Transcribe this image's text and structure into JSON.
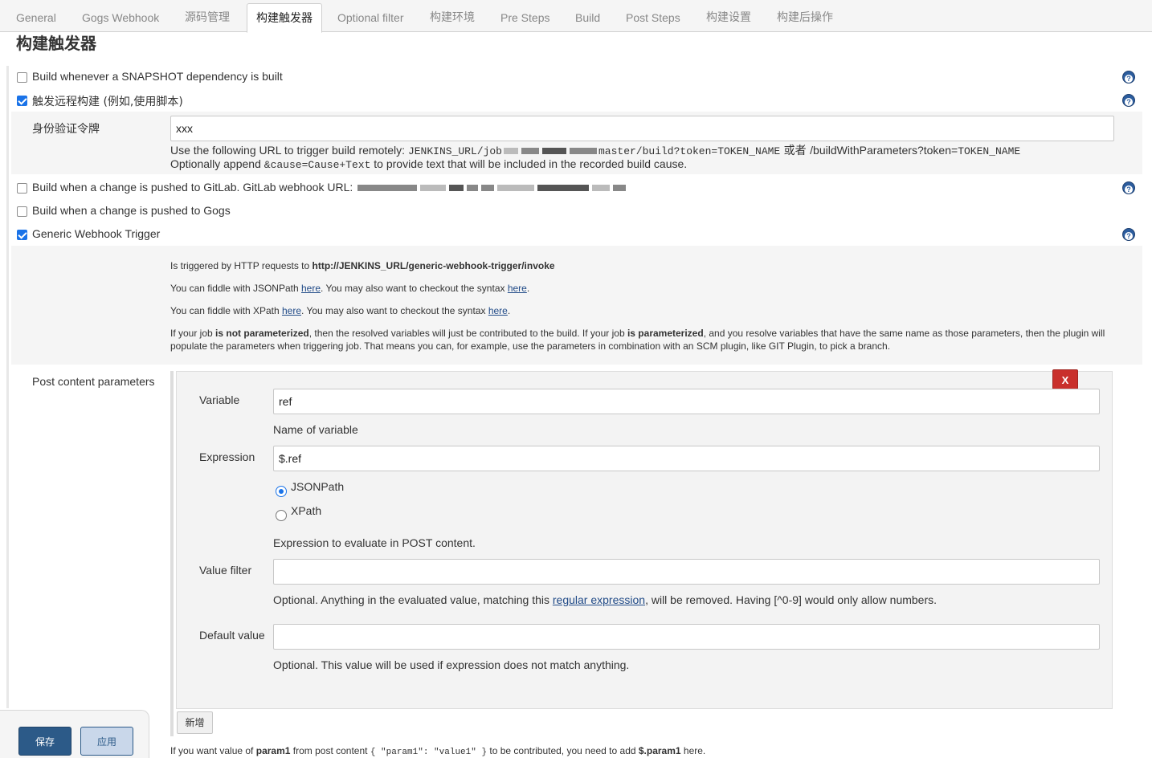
{
  "tabs": [
    {
      "label": "General"
    },
    {
      "label": "Gogs Webhook"
    },
    {
      "label": "源码管理"
    },
    {
      "label": "构建触发器"
    },
    {
      "label": "Optional filter"
    },
    {
      "label": "构建环境"
    },
    {
      "label": "Pre Steps"
    },
    {
      "label": "Build"
    },
    {
      "label": "Post Steps"
    },
    {
      "label": "构建设置"
    },
    {
      "label": "构建后操作"
    }
  ],
  "section": {
    "title": "构建触发器"
  },
  "triggers": {
    "snapshot": {
      "label": "Build whenever a SNAPSHOT dependency is built",
      "checked": false
    },
    "remote": {
      "label": "触发远程构建 (例如,使用脚本)",
      "checked": true
    },
    "token": {
      "label": "身份验证令牌",
      "value": "xxx",
      "url_prefix": "Use the following URL to trigger build remotely: ",
      "url_code_start": "JENKINS_URL/job",
      "url_code_mid": "master/build?token=TOKEN_NAME",
      "url_or": " 或者 ",
      "url_alt": "/buildWithParameters?token=",
      "url_alt_code": "TOKEN_NAME",
      "append_prefix": "Optionally append ",
      "append_code": "&cause=Cause+Text",
      "append_suffix": " to provide text that will be included in the recorded build cause."
    },
    "gitlab": {
      "label": "Build when a change is pushed to GitLab. GitLab webhook URL: ",
      "checked": false
    },
    "gogs": {
      "label": "Build when a change is pushed to Gogs",
      "checked": false
    },
    "generic": {
      "label": "Generic Webhook Trigger",
      "checked": true
    }
  },
  "generic_info": {
    "line1_prefix": "Is triggered by HTTP requests to ",
    "line1_url": "http://JENKINS_URL/generic-webhook-trigger/invoke",
    "line2_prefix": "You can fiddle with JSONPath ",
    "line2_link1": "here",
    "line2_mid": ". You may also want to checkout the syntax ",
    "line2_link2": "here",
    "line2_end": ".",
    "line3_prefix": "You can fiddle with XPath ",
    "line3_link1": "here",
    "line3_mid": ". You may also want to checkout the syntax ",
    "line3_link2": "here",
    "line3_end": ".",
    "para_a": "If your job ",
    "para_b": "is not parameterized",
    "para_c": ", then the resolved variables will just be contributed to the build. If your job ",
    "para_d": "is parameterized",
    "para_e": ", and you resolve variables that have the same name as those parameters, then the plugin will",
    "para_line2": "populate the parameters when triggering job. That means you can, for example, use the parameters in combination with an SCM plugin, like GIT Plugin, to pick a branch."
  },
  "post_content": {
    "label": "Post content parameters",
    "delete_label": "X",
    "variable": {
      "label": "Variable",
      "value": "ref",
      "hint": "Name of variable"
    },
    "expression": {
      "label": "Expression",
      "value": "$.ref",
      "options": [
        "JSONPath",
        "XPath"
      ],
      "selected": "JSONPath",
      "hint": "Expression to evaluate in POST content."
    },
    "value_filter": {
      "label": "Value filter",
      "value": "",
      "hint_prefix": "Optional. Anything in the evaluated value, matching this ",
      "hint_link": "regular expression",
      "hint_suffix": ", will be removed. Having [^0-9] would only allow numbers."
    },
    "default_value": {
      "label": "Default value",
      "value": "",
      "hint": "Optional. This value will be used if expression does not match anything."
    },
    "add_label": "新增"
  },
  "footer_note": {
    "a": "If you want value of ",
    "b": "param1",
    "c": " from post content ",
    "d": "{ \"param1\": \"value1\" }",
    "e": " to be contributed, you need to add ",
    "f": "$.param1",
    "g": " here."
  },
  "buttons": {
    "save": "保存",
    "apply": "应用"
  }
}
